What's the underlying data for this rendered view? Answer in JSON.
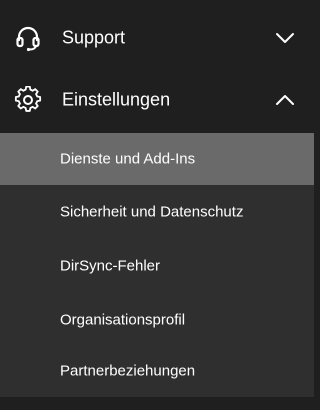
{
  "navigation": {
    "groups": [
      {
        "label": "Support",
        "icon": "headset-icon",
        "expanded": false
      },
      {
        "label": "Einstellungen",
        "icon": "gear-icon",
        "expanded": true
      }
    ],
    "settings_items": [
      {
        "label": "Dienste und Add-Ins",
        "selected": true
      },
      {
        "label": "Sicherheit und Datenschutz",
        "selected": false
      },
      {
        "label": "DirSync-Fehler",
        "selected": false
      },
      {
        "label": "Organisationsprofil",
        "selected": false
      },
      {
        "label": "Partnerbeziehungen",
        "selected": false
      }
    ]
  },
  "colors": {
    "background": "#1f1f1f",
    "submenu_background": "#2f2f2f",
    "selected_background": "#6a6a6a",
    "text": "#ffffff"
  }
}
